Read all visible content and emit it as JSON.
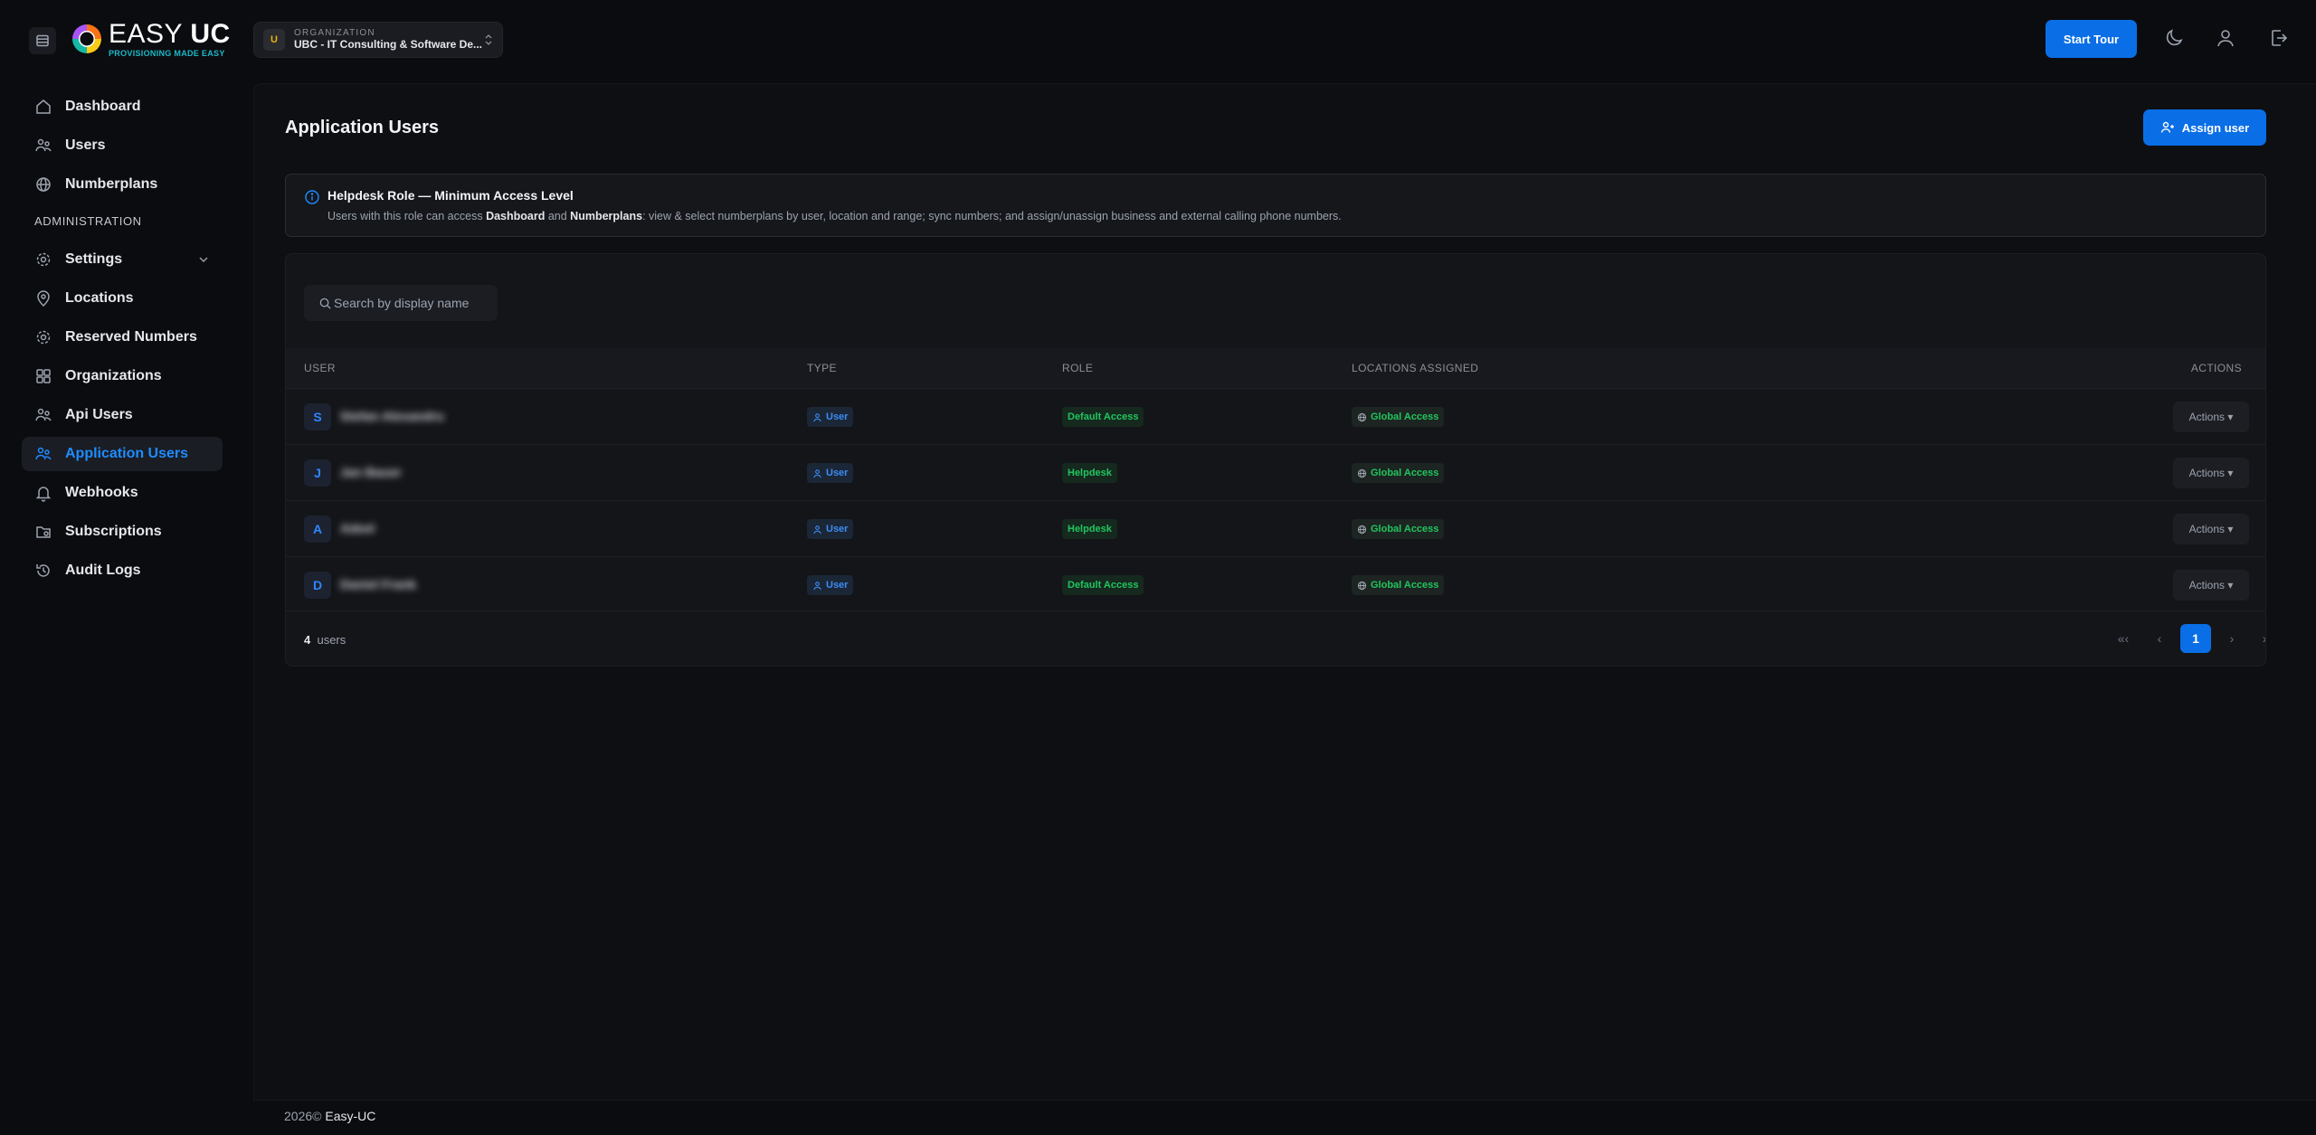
{
  "header": {
    "logo_title_light": "EASY",
    "logo_title_bold": "UC",
    "logo_tagline": "PROVISIONING MADE EASY",
    "org_label": "ORGANIZATION",
    "org_initial": "U",
    "org_name": "UBC - IT Consulting & Software De...",
    "start_tour": "Start Tour",
    "icons": [
      "menu-icon",
      "moon-icon",
      "user-icon",
      "logout-icon"
    ]
  },
  "sidebar": {
    "items_top": [
      {
        "label": "Dashboard",
        "icon": "home-icon"
      },
      {
        "label": "Users",
        "icon": "users-icon"
      },
      {
        "label": "Numberplans",
        "icon": "globe-icon"
      }
    ],
    "section_label": "ADMINISTRATION",
    "items_admin": [
      {
        "label": "Settings",
        "icon": "gear-icon"
      },
      {
        "label": "Locations",
        "icon": "map-pin-icon"
      },
      {
        "label": "Reserved Numbers",
        "icon": "gear-icon"
      },
      {
        "label": "Organizations",
        "icon": "grid-icon"
      },
      {
        "label": "Api Users",
        "icon": "users-icon"
      },
      {
        "label": "Application Users",
        "icon": "users-icon",
        "active": true
      },
      {
        "label": "Webhooks",
        "icon": "bell-icon"
      },
      {
        "label": "Subscriptions",
        "icon": "folder-icon"
      },
      {
        "label": "Audit Logs",
        "icon": "history-icon"
      }
    ]
  },
  "main": {
    "title": "Application Users",
    "assign_button": "Assign user",
    "info": {
      "title": "Helpdesk Role — Minimum Access Level",
      "desc_prefix": "Users with this role can access ",
      "desc_bold1": "Dashboard",
      "desc_and": " and ",
      "desc_bold2": "Numberplans",
      "desc_suffix": ": view & select numberplans by user, location and range; sync numbers; and assign/unassign business and external calling phone numbers."
    },
    "search_placeholder": "Search by display name",
    "columns": [
      "USER",
      "TYPE",
      "ROLE",
      "LOCATIONS ASSIGNED",
      "ACTIONS"
    ],
    "rows": [
      {
        "initial": "S",
        "name": "Stefan Alexandru",
        "type": "User",
        "role": "Default Access",
        "locations": "Global Access",
        "action": "Actions ▾"
      },
      {
        "initial": "J",
        "name": "Jan Bauer",
        "type": "User",
        "role": "Helpdesk",
        "locations": "Global Access",
        "action": "Actions ▾"
      },
      {
        "initial": "A",
        "name": "Adeel",
        "type": "User",
        "role": "Helpdesk",
        "locations": "Global Access",
        "action": "Actions ▾"
      },
      {
        "initial": "D",
        "name": "Daniel Frank",
        "type": "User",
        "role": "Default Access",
        "locations": "Global Access",
        "action": "Actions ▾"
      }
    ],
    "count": "4",
    "count_label": "users",
    "pagination": {
      "first": "«‹",
      "prev": "‹",
      "current": "1",
      "next": "›",
      "last": "›»"
    }
  },
  "footer": {
    "year": "2026©",
    "brand": "Easy-UC"
  },
  "colors": {
    "accent": "#0a6ee6",
    "success": "#22c55e",
    "background": "#0b0c0f"
  }
}
